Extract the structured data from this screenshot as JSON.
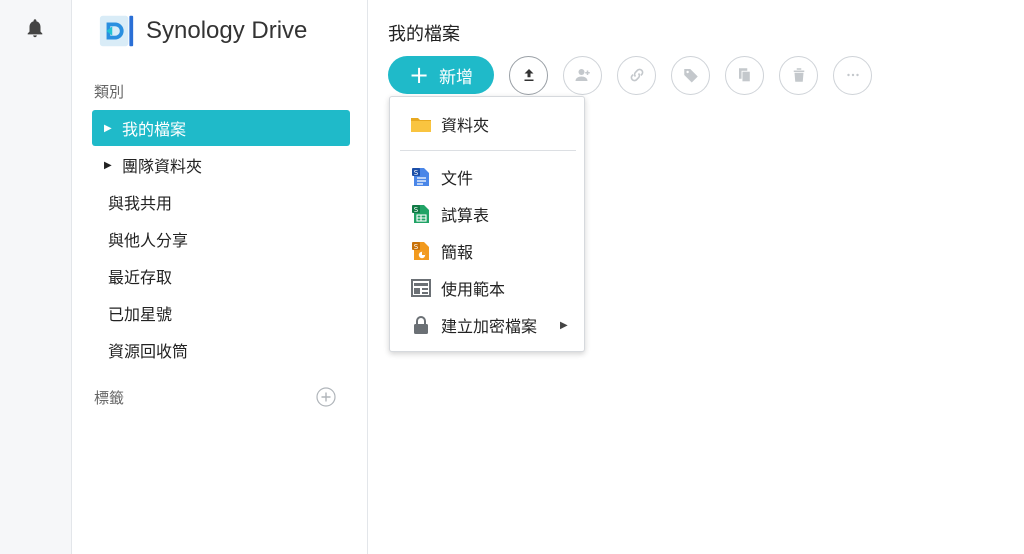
{
  "app": {
    "name": "Synology Drive"
  },
  "sidebar": {
    "category_label": "類別",
    "items": [
      {
        "label": "我的檔案",
        "expandable": true,
        "active": true
      },
      {
        "label": "團隊資料夾",
        "expandable": true,
        "active": false
      },
      {
        "label": "與我共用",
        "expandable": false,
        "active": false
      },
      {
        "label": "與他人分享",
        "expandable": false,
        "active": false
      },
      {
        "label": "最近存取",
        "expandable": false,
        "active": false
      },
      {
        "label": "已加星號",
        "expandable": false,
        "active": false
      },
      {
        "label": "資源回收筒",
        "expandable": false,
        "active": false
      }
    ],
    "tags_label": "標籤"
  },
  "main": {
    "title": "我的檔案",
    "new_button_label": "新增"
  },
  "toolbar_icons": [
    "upload-icon",
    "share-user-icon",
    "link-icon",
    "tag-icon",
    "copy-icon",
    "trash-icon",
    "more-icon"
  ],
  "new_menu": {
    "items": [
      {
        "label": "資料夾",
        "icon": "folder-icon"
      },
      {
        "label": "文件",
        "icon": "document-icon"
      },
      {
        "label": "試算表",
        "icon": "spreadsheet-icon"
      },
      {
        "label": "簡報",
        "icon": "presentation-icon"
      },
      {
        "label": "使用範本",
        "icon": "template-icon"
      },
      {
        "label": "建立加密檔案",
        "icon": "lock-icon",
        "has_submenu": true
      }
    ]
  },
  "colors": {
    "accent": "#1fbac9",
    "folder": "#f9c440",
    "doc": "#2d6ad6",
    "sheet": "#21a366",
    "slide": "#f29a1e"
  }
}
